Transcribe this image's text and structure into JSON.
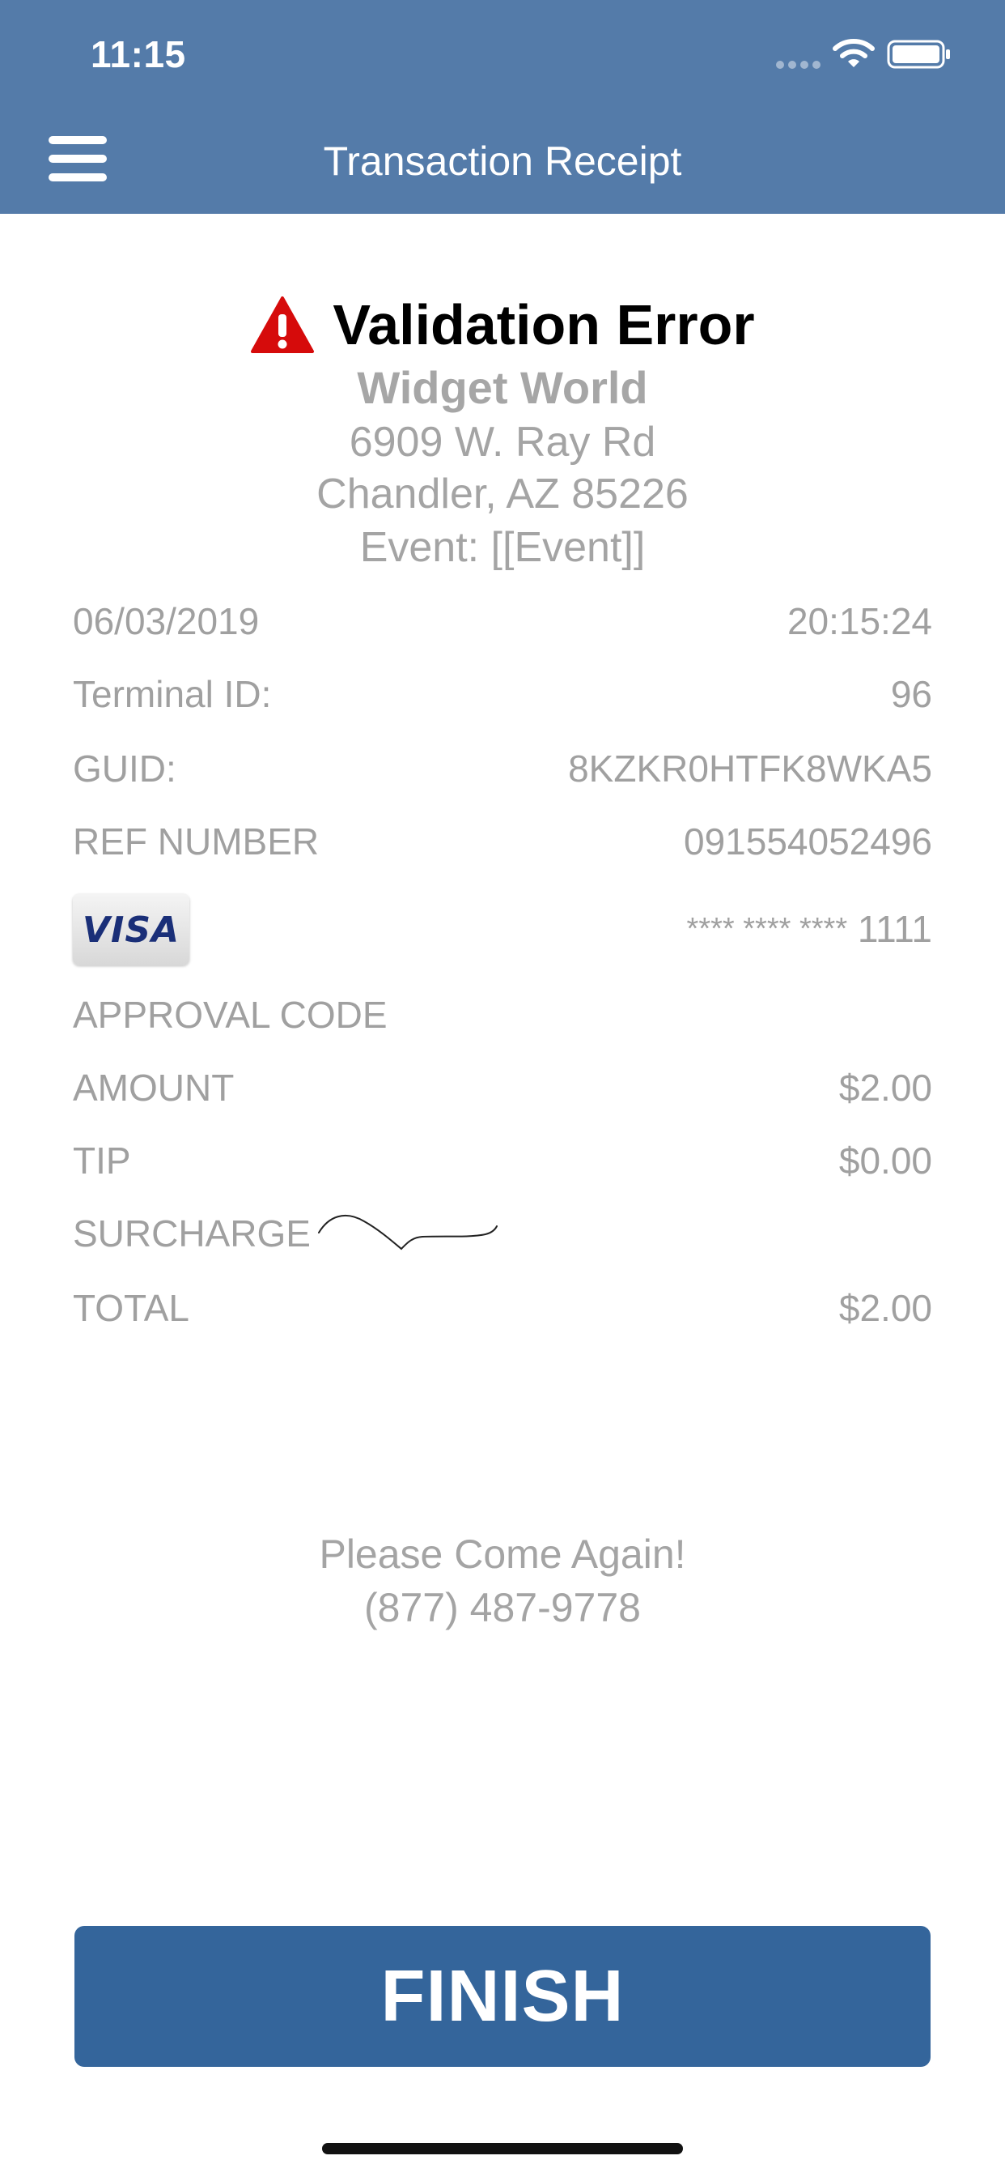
{
  "status_bar": {
    "time": "11:15"
  },
  "nav": {
    "title": "Transaction Receipt"
  },
  "receipt": {
    "error_title": "Validation Error",
    "merchant_name": "Widget World",
    "address_line1": "6909 W. Ray Rd",
    "address_line2": "Chandler, AZ 85226",
    "event": "Event: [[Event]]",
    "date": "06/03/2019",
    "time": "20:15:24",
    "terminal_label": "Terminal ID:",
    "terminal_value": "96",
    "guid_label": "GUID:",
    "guid_value": "8KZKR0HTFK8WKA5",
    "ref_label": "REF NUMBER",
    "ref_value": "091554052496",
    "card_brand": "VISA",
    "card_mask": "**** **** ****",
    "card_last4": "1111",
    "approval_label": "APPROVAL CODE",
    "amount_label": "AMOUNT",
    "amount_value": "$2.00",
    "tip_label": "TIP",
    "tip_value": "$0.00",
    "surcharge_label": "SURCHARGE",
    "total_label": "TOTAL",
    "total_value": "$2.00",
    "footer_message": "Please Come Again!",
    "phone": "(877) 487-9778"
  },
  "actions": {
    "finish_label": "FINISH"
  },
  "colors": {
    "header_bg": "#547ba9",
    "button_bg": "#34659b",
    "warning_red": "#d60b0b",
    "muted_text": "#a0a0a0"
  }
}
